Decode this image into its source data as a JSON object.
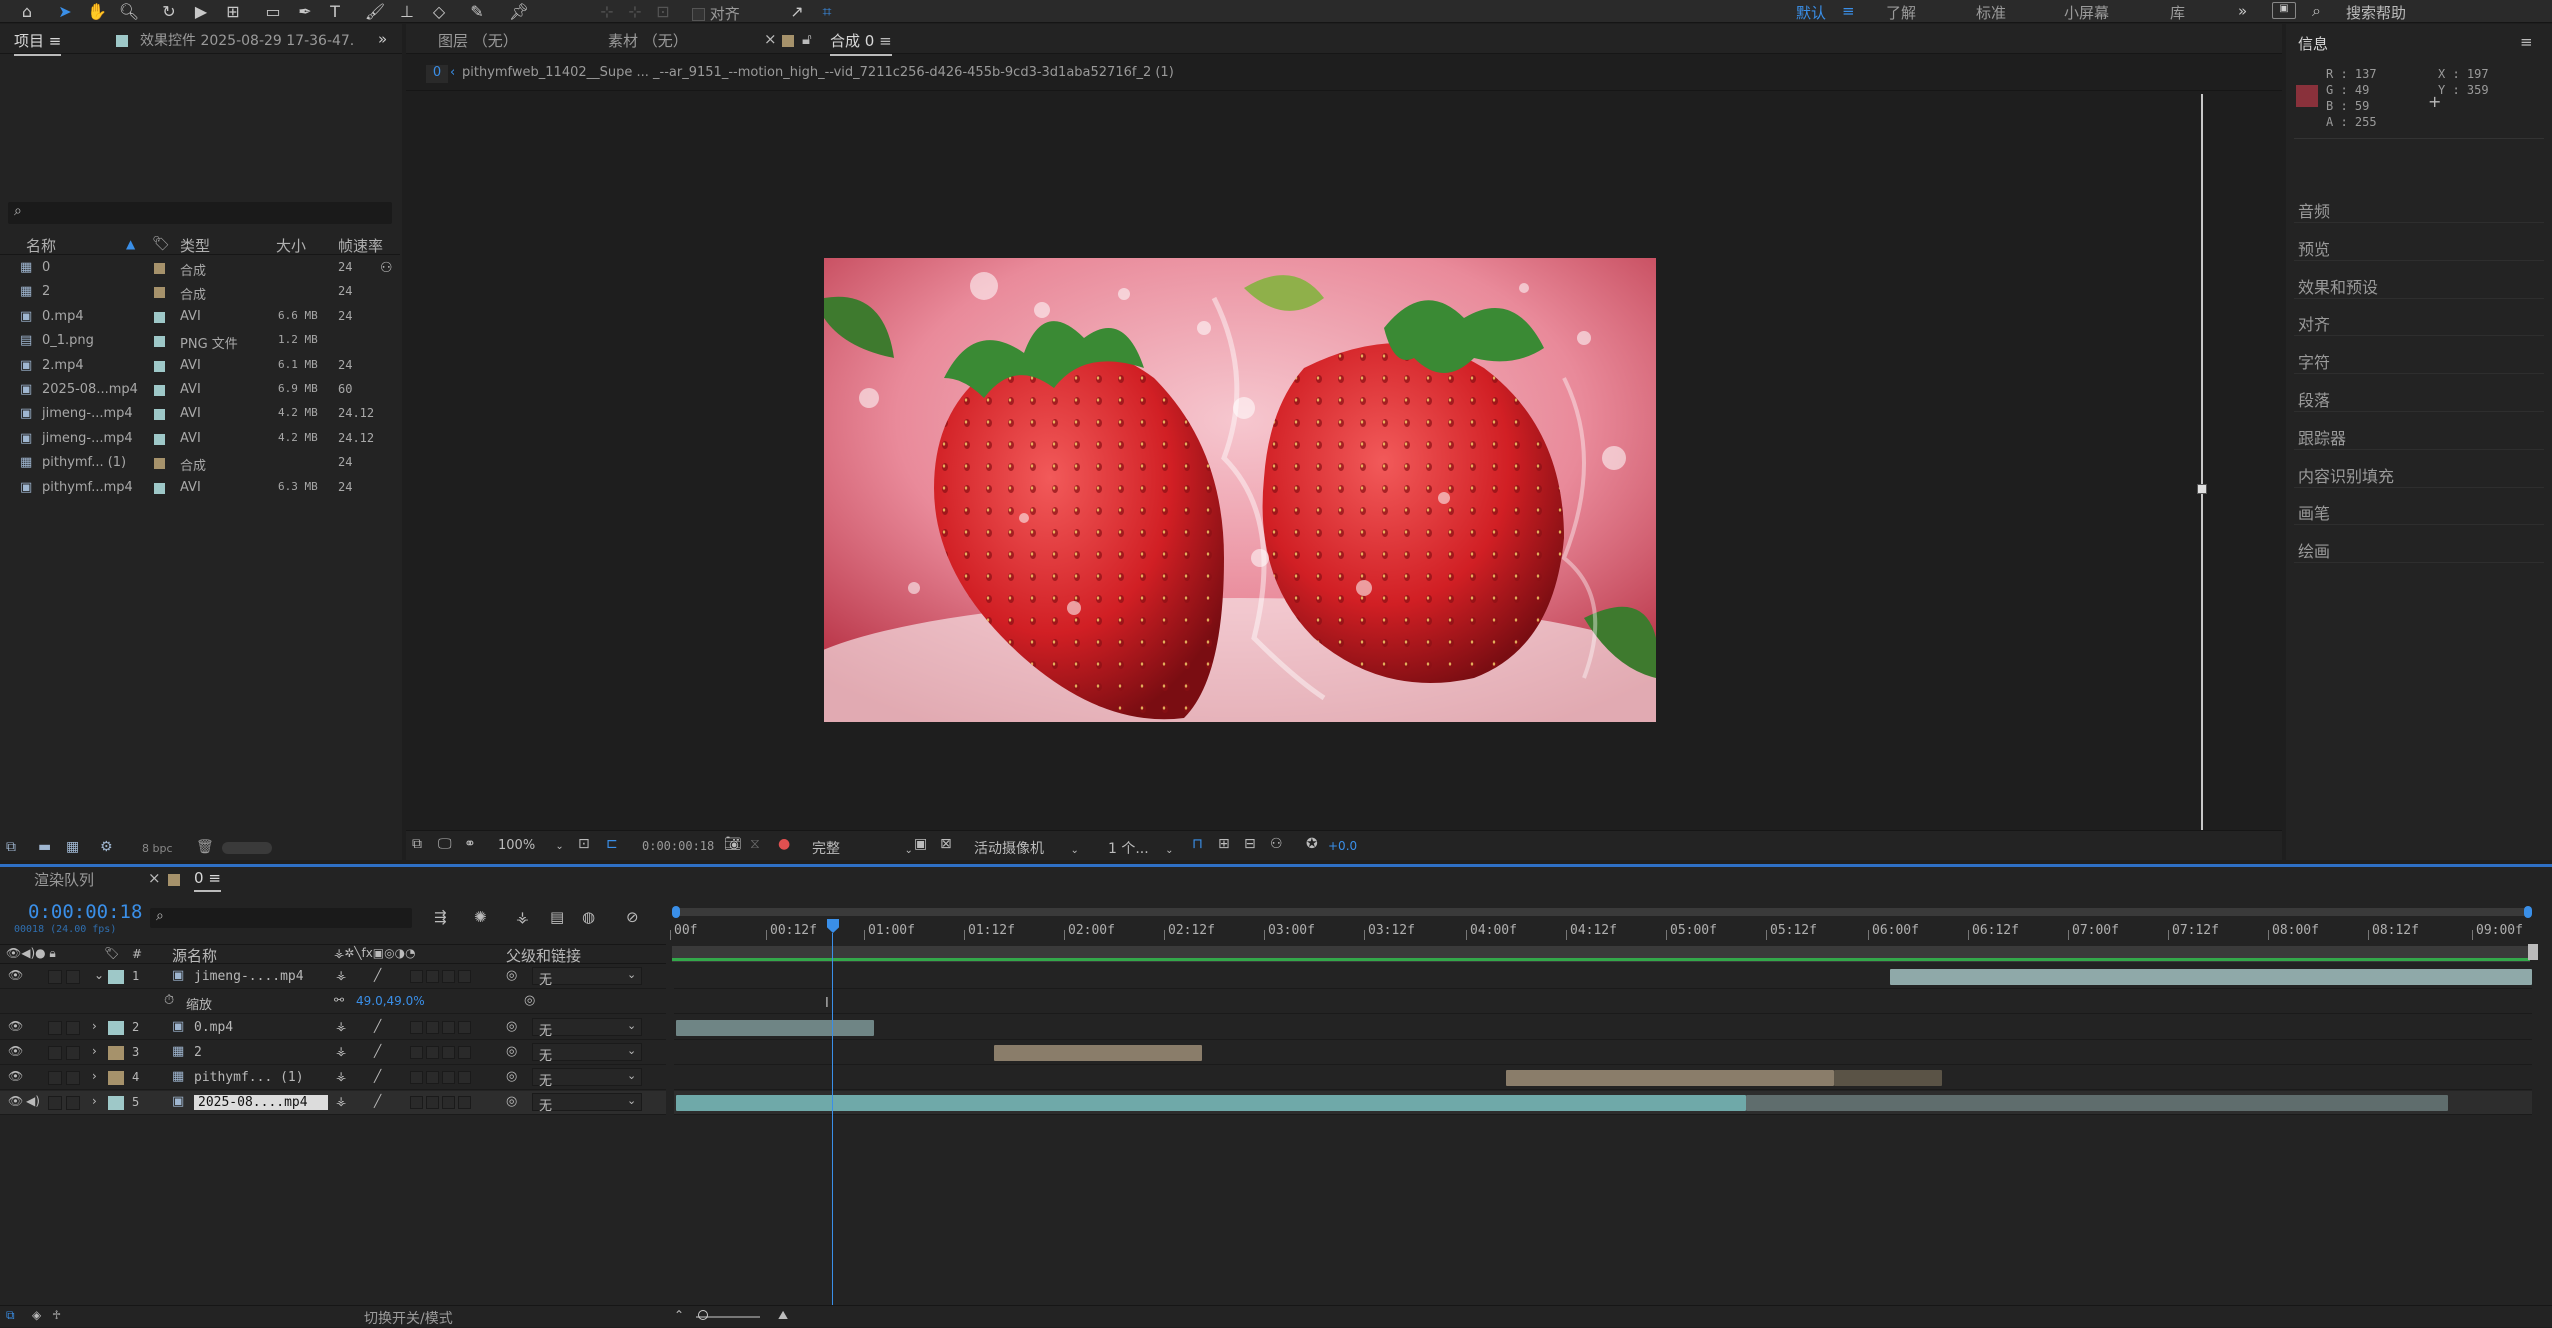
{
  "toolbar": {
    "snap_label": "对齐",
    "workspaces": [
      "默认",
      "了解",
      "标准",
      "小屏幕",
      "库"
    ],
    "active_workspace": "默认",
    "search_placeholder": "搜索帮助"
  },
  "project_panel": {
    "tab_label": "项目",
    "effects_tab_label": "效果控件 2025-08-29 17-36-47.",
    "columns": [
      "名称",
      "类型",
      "大小",
      "帧速率"
    ],
    "items": [
      {
        "name": "0",
        "type": "合成",
        "size": "",
        "fps": "24",
        "icon": "composition-icon",
        "color": "#a6926b"
      },
      {
        "name": "2",
        "type": "合成",
        "size": "",
        "fps": "24",
        "icon": "composition-icon",
        "color": "#a6926b"
      },
      {
        "name": "0.mp4",
        "type": "AVI",
        "size": "6.6 MB",
        "fps": "24",
        "icon": "video-file-icon",
        "color": "#9ec8c8"
      },
      {
        "name": "0_1.png",
        "type": "PNG 文件",
        "size": "1.2 MB",
        "fps": "",
        "icon": "image-file-icon",
        "color": "#9ec8c8"
      },
      {
        "name": "2.mp4",
        "type": "AVI",
        "size": "6.1 MB",
        "fps": "24",
        "icon": "video-file-icon",
        "color": "#9ec8c8"
      },
      {
        "name": "2025-08...mp4",
        "type": "AVI",
        "size": "6.9 MB",
        "fps": "60",
        "icon": "video-file-icon",
        "color": "#9ec8c8"
      },
      {
        "name": "jimeng-...mp4",
        "type": "AVI",
        "size": "4.2 MB",
        "fps": "24.12",
        "icon": "video-file-icon",
        "color": "#9ec8c8"
      },
      {
        "name": "jimeng-...mp4",
        "type": "AVI",
        "size": "4.2 MB",
        "fps": "24.12",
        "icon": "video-file-icon",
        "color": "#9ec8c8"
      },
      {
        "name": "pithymf... (1)",
        "type": "合成",
        "size": "",
        "fps": "24",
        "icon": "composition-icon",
        "color": "#a6926b"
      },
      {
        "name": "pithymf...mp4",
        "type": "AVI",
        "size": "6.3 MB",
        "fps": "24",
        "icon": "video-file-icon",
        "color": "#9ec8c8"
      }
    ],
    "bpc_label": "8 bpc"
  },
  "viewer": {
    "tabs": [
      "图层 （无）",
      "素材 （无）",
      "合成 0"
    ],
    "active_tab": "合成 0",
    "breadcrumb_index": "0",
    "breadcrumb_path": "pithymfweb_11402__Supe ... _--ar_9151_--motion_high_--vid_7211c256-d426-455b-9cd3-3d1aba52716f_2 (1)",
    "zoom": "100%",
    "timecode": "0:00:00:18",
    "resolution": "完整",
    "camera": "活动摄像机",
    "views": "1 个...",
    "exposure": "+0.0"
  },
  "info_panel": {
    "title": "信息",
    "r": "R : 137",
    "g": "G : 49",
    "b": "B : 59",
    "a": "A : 255",
    "x": "X : 197",
    "y": "Y : 359",
    "swatch_color": "#89313b",
    "sections": [
      "音频",
      "预览",
      "效果和预设",
      "对齐",
      "字符",
      "段落",
      "跟踪器",
      "内容识别填充",
      "画笔",
      "绘画"
    ]
  },
  "timeline": {
    "render_queue_tab": "渲染队列",
    "comp_tab": "0",
    "current_time": "0:00:00:18",
    "frame_info": "00018 (24.00 fps)",
    "columns": {
      "source_name": "源名称",
      "parent": "父级和链接"
    },
    "ruler_labels": [
      "00f",
      "00:12f",
      "01:00f",
      "01:12f",
      "02:00f",
      "02:12f",
      "03:00f",
      "03:12f",
      "04:00f",
      "04:12f",
      "05:00f",
      "05:12f",
      "06:00f",
      "06:12f",
      "07:00f",
      "07:12f",
      "08:00f",
      "08:12f",
      "09:00f"
    ],
    "layers": [
      {
        "num": "1",
        "name": "jimeng-....mp4",
        "parent": "无",
        "color": "#9ec8c8",
        "icon": "video-file-icon"
      },
      {
        "num": "2",
        "name": "0.mp4",
        "parent": "无",
        "color": "#9ec8c8",
        "icon": "video-file-icon"
      },
      {
        "num": "3",
        "name": "2",
        "parent": "无",
        "color": "#a6926b",
        "icon": "composition-icon"
      },
      {
        "num": "4",
        "name": "pithymf... (1)",
        "parent": "无",
        "color": "#a6926b",
        "icon": "composition-icon"
      },
      {
        "num": "5",
        "name": "2025-08....mp4",
        "parent": "无",
        "color": "#9ec8c8",
        "icon": "video-file-icon"
      }
    ],
    "scale_property": {
      "label": "缩放",
      "value": "49.0,49.0%"
    },
    "toggle_label": "切换开关/模式"
  }
}
